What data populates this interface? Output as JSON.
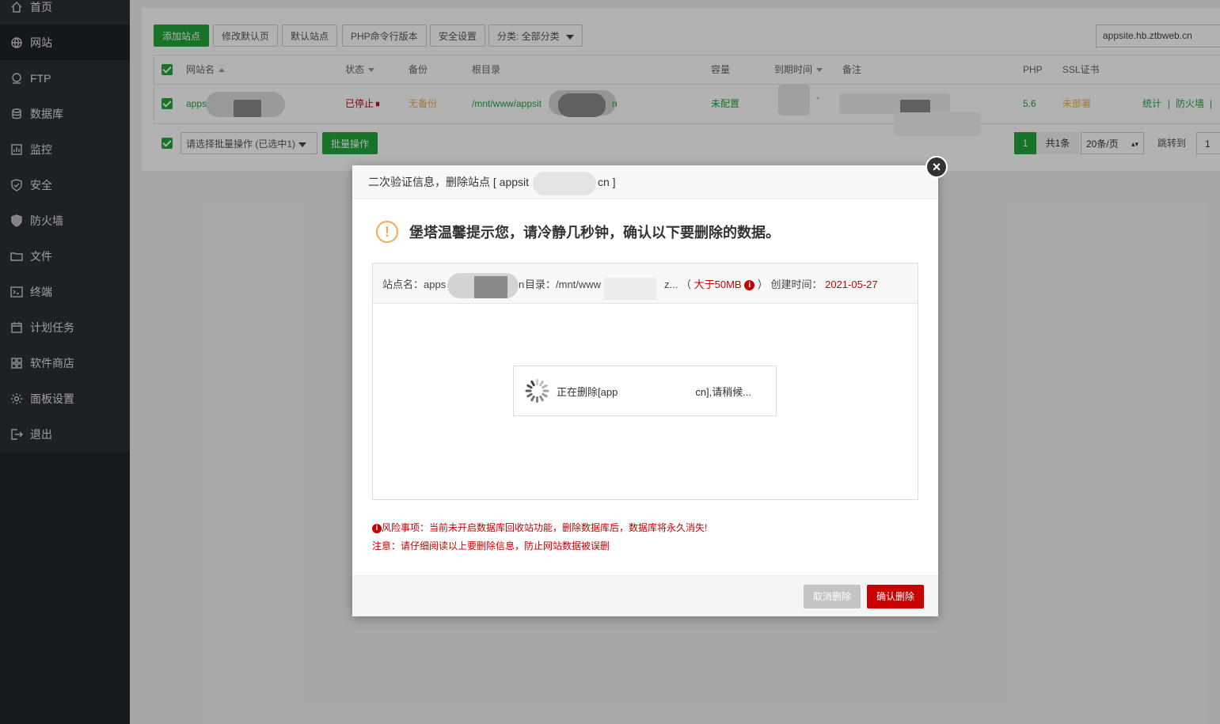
{
  "sidebar": {
    "items": [
      {
        "label": "首页",
        "icon": "home-icon"
      },
      {
        "label": "网站",
        "icon": "globe-icon"
      },
      {
        "label": "FTP",
        "icon": "ftp-icon"
      },
      {
        "label": "数据库",
        "icon": "database-icon"
      },
      {
        "label": "监控",
        "icon": "monitor-icon"
      },
      {
        "label": "安全",
        "icon": "shield-icon"
      },
      {
        "label": "防火墙",
        "icon": "firewall-icon"
      },
      {
        "label": "文件",
        "icon": "folder-icon"
      },
      {
        "label": "终端",
        "icon": "terminal-icon"
      },
      {
        "label": "计划任务",
        "icon": "calendar-icon"
      },
      {
        "label": "软件商店",
        "icon": "apps-icon"
      },
      {
        "label": "面板设置",
        "icon": "gear-icon"
      },
      {
        "label": "退出",
        "icon": "logout-icon"
      }
    ]
  },
  "toolbar": {
    "add_site": "添加站点",
    "edit_default_page": "修改默认页",
    "default_site": "默认站点",
    "php_cli": "PHP命令行版本",
    "security": "安全设置",
    "category": "分类: 全部分类",
    "search_value": "appsite.hb.ztbweb.cn"
  },
  "table": {
    "headers": {
      "name": "网站名",
      "status": "状态",
      "backup": "备份",
      "root": "根目录",
      "quota": "容量",
      "expire": "到期时间",
      "remark": "备注",
      "php": "PHP",
      "ssl": "SSL证书"
    },
    "row": {
      "name": "apps",
      "status": "已停止",
      "backup": "无备份",
      "root": "/mnt/www/appsit",
      "root_tail": "n",
      "quota": "未配置",
      "expire_dash": "-",
      "php": "5.6",
      "ssl": "未部署",
      "action_stats": "统计",
      "action_firewall": "防火墙",
      "sep": "|"
    }
  },
  "batch": {
    "select": "请选择批量操作 (已选中1)",
    "button": "批量操作"
  },
  "pagination": {
    "current": "1",
    "total": "共1条",
    "per_page": "20条/页",
    "jump_label": "跳转到",
    "jump_value": "1"
  },
  "modal": {
    "title": "二次验证信息，删除站点 [ appsit",
    "title_tail": "cn ]",
    "close": "×",
    "warning": "堡塔温馨提示您，请冷静几秒钟，确认以下要删除的数据。",
    "site_label": "站点名：apps",
    "site_tail": "n",
    "dir_label": "目录：/mnt/www",
    "dir_tail": "z...",
    "size_open": "（",
    "size": "大于50MB",
    "size_close": "）",
    "created_label": "创建时间：",
    "created": "2021-05-27",
    "risk": "风险事项：当前未开启数据库回收站功能，删除数据库后，数据库将永久消失!",
    "note": "注意：请仔细阅读以上要删除信息，防止网站数据被误删",
    "cancel": "取消删除",
    "confirm": "确认删除"
  },
  "loading": {
    "text_start": "正在删除[app",
    "text_end": "cn],请稍候..."
  },
  "colors": {
    "sidebar_bg": "#20252a",
    "green": "#20a53a",
    "danger": "#c80000",
    "warning": "#f0ad4e"
  }
}
